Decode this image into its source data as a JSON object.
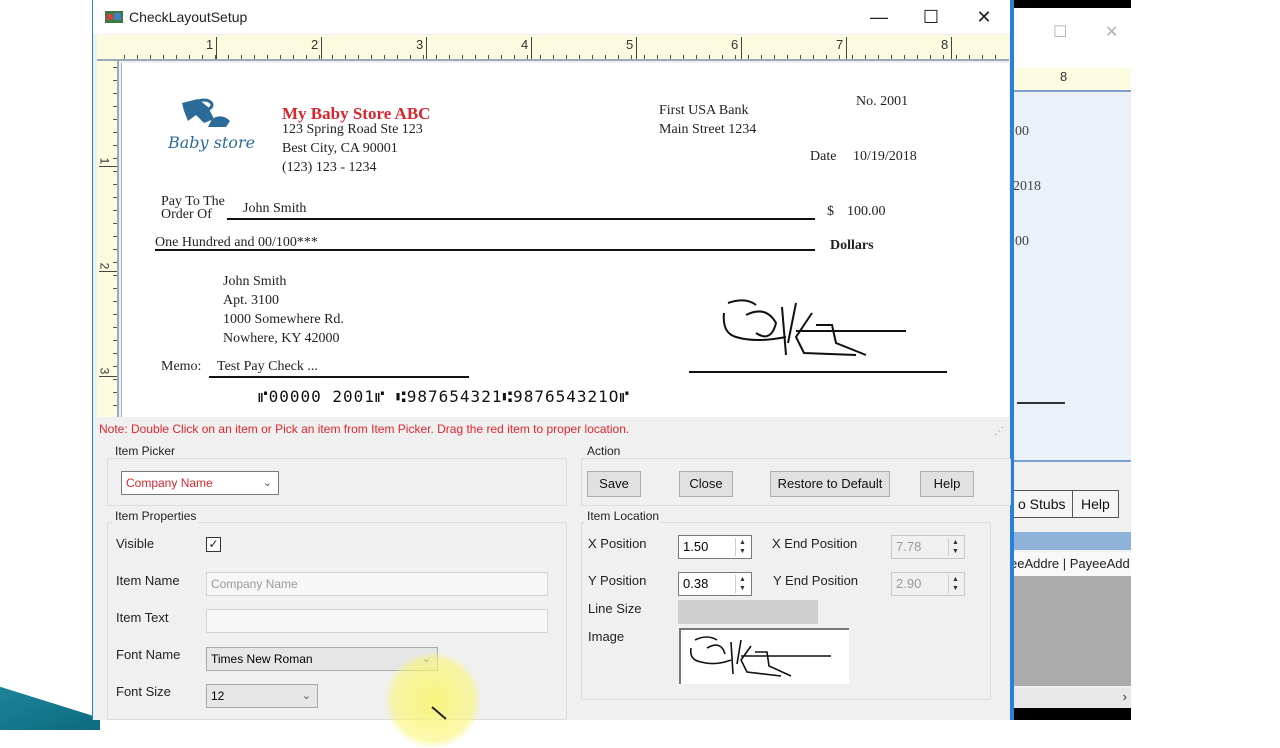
{
  "window": {
    "title": "CheckLayoutSetup",
    "controls": {
      "minimize": "—",
      "maximize": "☐",
      "close": "✕"
    }
  },
  "ruler": {
    "horizontal": [
      "1",
      "2",
      "3",
      "4",
      "5",
      "6",
      "7",
      "8"
    ],
    "vertical": [
      "1",
      "2",
      "3"
    ]
  },
  "check": {
    "logo_text": "Baby store",
    "company_name": "My Baby Store ABC",
    "company_address1": "123 Spring Road Ste 123",
    "company_address2": "Best City, CA 90001",
    "company_phone": "(123) 123 - 1234",
    "bank_name": "First USA Bank",
    "bank_address": "Main Street 1234",
    "check_no": "No. 2001",
    "date_label": "Date",
    "date_value": "10/19/2018",
    "pay_to_label_1": "Pay To The",
    "pay_to_label_2": "Order Of",
    "payee_name": "John Smith",
    "currency_symbol": "$",
    "amount": "100.00",
    "amount_words": "One Hundred  and 00/100***",
    "dollars_label": "Dollars",
    "payee_address": [
      "John Smith",
      "Apt. 3100",
      "1000 Somewhere Rd.",
      "Nowhere, KY 42000"
    ],
    "memo_label": "Memo:",
    "memo_value": "Test Pay Check ...",
    "micr_line": "⑈00000 2001⑈ ⑆987654321⑆987654321O⑈"
  },
  "note": "Note: Double Click on an item or Pick an item from Item Picker. Drag the red item to proper location.",
  "item_picker": {
    "label": "Item Picker",
    "selected": "Company Name"
  },
  "action": {
    "label": "Action",
    "save": "Save",
    "close": "Close",
    "restore": "Restore to Default",
    "help": "Help"
  },
  "item_properties": {
    "label": "Item Properties",
    "visible_label": "Visible",
    "visible_checked": true,
    "item_name_label": "Item Name",
    "item_name_value": "Company Name",
    "item_text_label": "Item Text",
    "item_text_value": "",
    "font_name_label": "Font Name",
    "font_name_value": "Times New Roman",
    "font_size_label": "Font Size",
    "font_size_value": "12"
  },
  "item_location": {
    "label": "Item Location",
    "x_label": "X Position",
    "x_value": "1.50",
    "x_end_label": "X End Position",
    "x_end_value": "7.78",
    "y_label": "Y Position",
    "y_value": "0.38",
    "y_end_label": "Y End Position",
    "y_end_value": "2.90",
    "line_size_label": "Line Size",
    "image_label": "Image"
  },
  "background_window": {
    "ruler_number": "8",
    "paper_fragments": [
      "00",
      "2018",
      "00"
    ],
    "buttons": [
      "o Stubs",
      "Help"
    ],
    "column_headers": "eeAddre | PayeeAdd"
  }
}
